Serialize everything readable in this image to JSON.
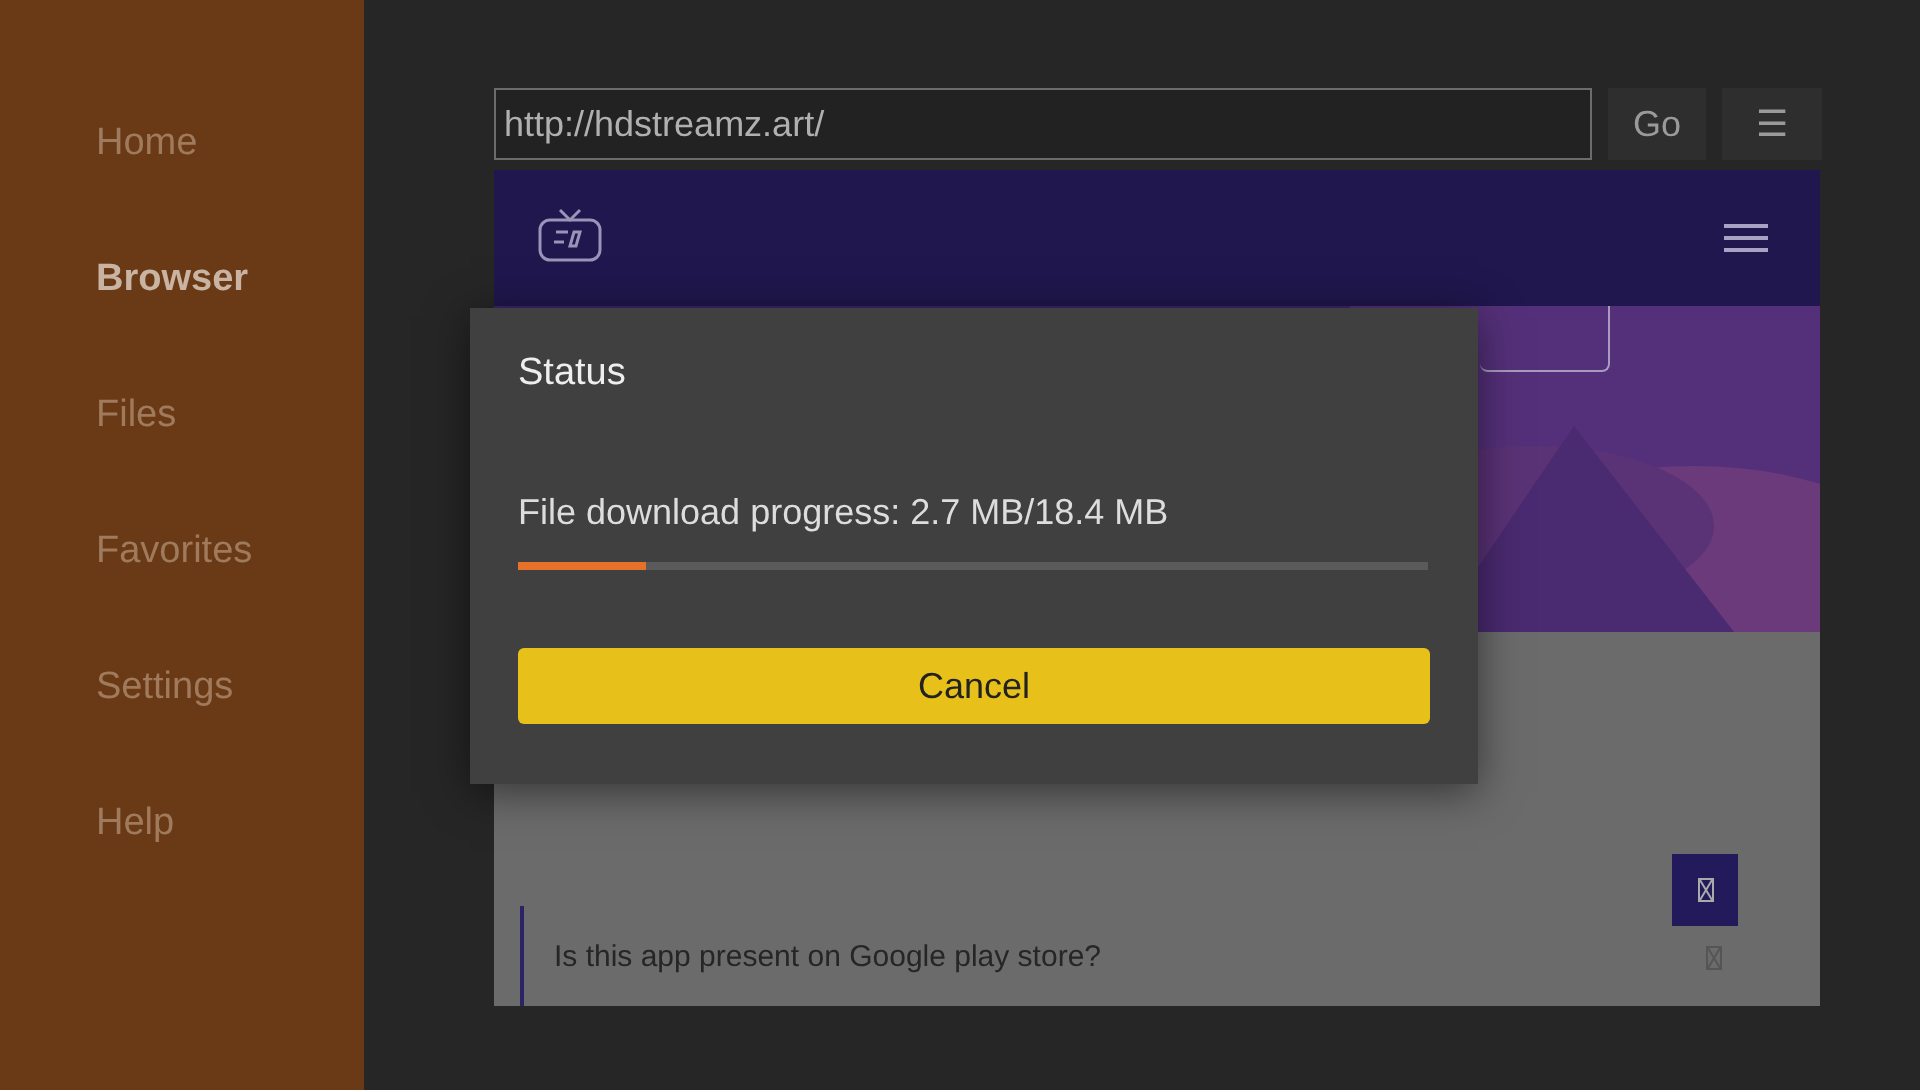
{
  "sidebar": {
    "items": [
      {
        "label": "Home",
        "selected": false
      },
      {
        "label": "Browser",
        "selected": true
      },
      {
        "label": "Files",
        "selected": false
      },
      {
        "label": "Favorites",
        "selected": false
      },
      {
        "label": "Settings",
        "selected": false
      },
      {
        "label": "Help",
        "selected": false
      }
    ]
  },
  "address_bar": {
    "value": "http://hdstreamz.art/"
  },
  "go_button": "Go",
  "menu_button": "☰",
  "webpage": {
    "faq_question": "Is this app present on Google play store?"
  },
  "dialog": {
    "title": "Status",
    "message": "File download progress: 2.7 MB/18.4 MB",
    "progress": {
      "level": 0.14
    },
    "button": "Cancel"
  }
}
